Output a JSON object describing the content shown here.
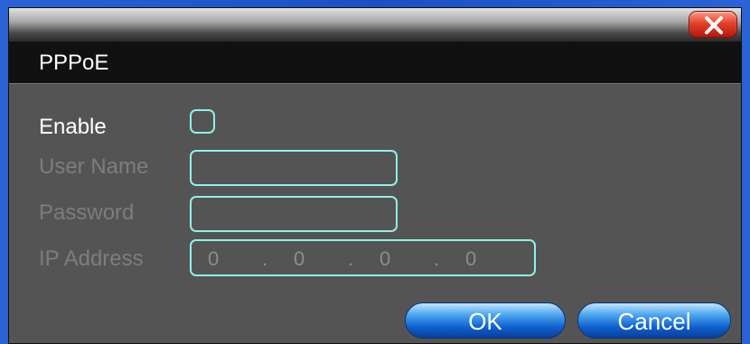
{
  "dialog": {
    "title": "PPPoE",
    "close_icon": "close-icon"
  },
  "form": {
    "enable_label": "Enable",
    "enable_checked": false,
    "username_label": "User Name",
    "username_value": "",
    "password_label": "Password",
    "password_value": "",
    "ip_label": "IP Address",
    "ip_octets": [
      "0",
      "0",
      "0",
      "0"
    ],
    "ip_separator": "."
  },
  "buttons": {
    "ok_label": "OK",
    "cancel_label": "Cancel"
  },
  "colors": {
    "field_border": "#8ff1e8",
    "panel_bg": "#545454",
    "titlebar_bg": "#111111",
    "disabled_text": "#7d7d7d",
    "close_button": "#e5412c",
    "button_blue": "#0d5fcf"
  }
}
